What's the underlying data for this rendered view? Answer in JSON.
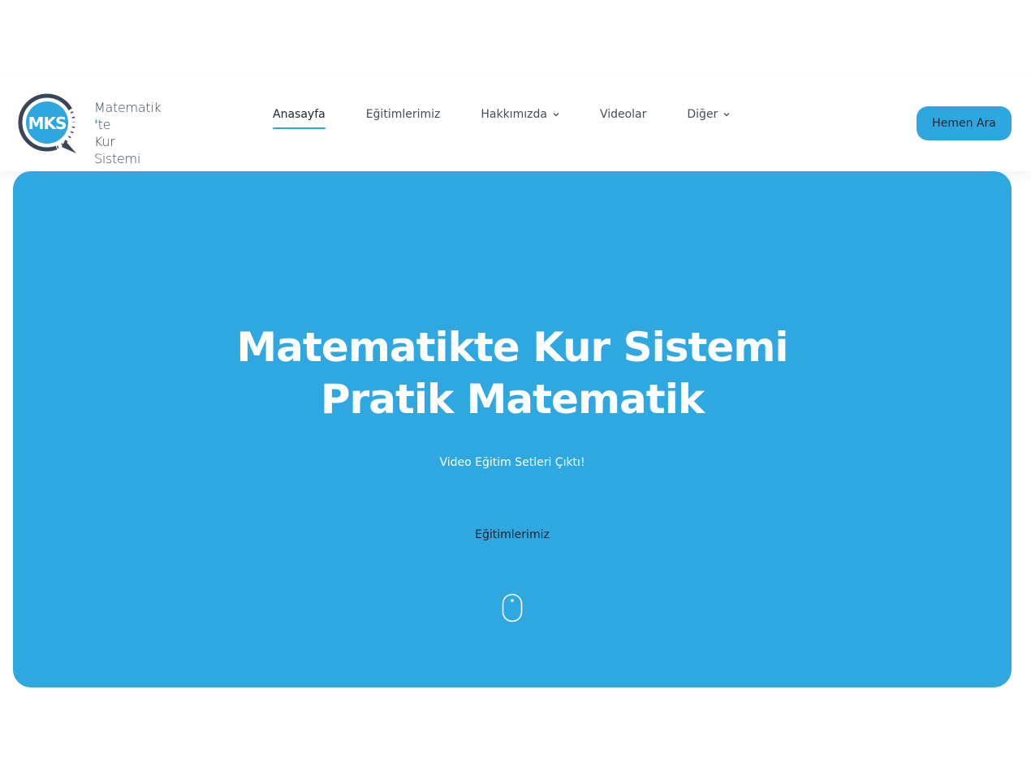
{
  "brand": {
    "logo_initials": "MKS",
    "logo_line1": "Matematik",
    "logo_line1_mark": "'",
    "logo_line1_suffix": "te",
    "logo_line2": "Kur",
    "logo_line3": "Sistemi",
    "accent_color": "#2ea6e0",
    "dark_color": "#3a4656"
  },
  "nav": {
    "items": [
      {
        "label": "Anasayfa",
        "active": true
      },
      {
        "label": "Eğitimlerimiz"
      },
      {
        "label": "Hakkımızda",
        "icon": "chevron-down-icon"
      },
      {
        "label": "Videolar"
      },
      {
        "label": "Diğer",
        "icon": "chevron-down-icon"
      }
    ],
    "cta_label": "Hemen Ara"
  },
  "hero": {
    "title_line1": "Matematikte Kur Sistemi",
    "title_line2": "Pratik Matematik",
    "subtitle": "Video Eğitim Setleri Çıktı!",
    "link_label": "Eğitimlerimiz",
    "scroll_icon": "mouse-icon",
    "background": "#2fa7e1"
  }
}
